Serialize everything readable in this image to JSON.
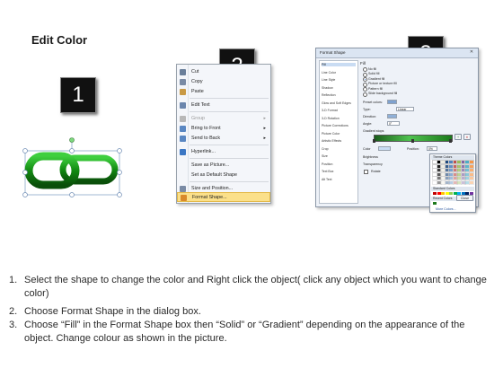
{
  "page": {
    "title": "Edit Color",
    "steps": [
      "1",
      "2",
      "3"
    ]
  },
  "context_menu": {
    "items": [
      {
        "label": "Cut",
        "icon": "scissors-icon",
        "color": "#6a7f9a"
      },
      {
        "label": "Copy",
        "icon": "copy-icon",
        "color": "#7a8ba5"
      },
      {
        "label": "Paste",
        "icon": "paste-icon",
        "color": "#c99a45"
      },
      {
        "label": "Edit Text",
        "icon": "edit-text-icon",
        "color": "#6b86ad"
      },
      {
        "label": "Group",
        "icon": "group-icon",
        "color": "#b8b8b8",
        "disabled": true,
        "submenu": true
      },
      {
        "label": "Bring to Front",
        "icon": "bring-front-icon",
        "color": "#5a87c2",
        "submenu": true
      },
      {
        "label": "Send to Back",
        "icon": "send-back-icon",
        "color": "#5a87c2",
        "submenu": true
      },
      {
        "label": "Hyperlink...",
        "icon": "hyperlink-icon",
        "color": "#3b77c4"
      },
      {
        "label": "Save as Picture...",
        "icon": "",
        "color": ""
      },
      {
        "label": "Set as Default Shape",
        "icon": "",
        "color": ""
      },
      {
        "label": "Size and Position...",
        "icon": "size-position-icon",
        "color": "#7a8ba5"
      },
      {
        "label": "Format Shape...",
        "icon": "format-shape-icon",
        "color": "#d98a2b",
        "highlighted": true
      }
    ]
  },
  "dialog": {
    "title": "Format Shape",
    "categories": [
      "Fill",
      "Line Color",
      "Line Style",
      "Shadow",
      "Reflection",
      "Glow and Soft Edges",
      "3-D Format",
      "3-D Rotation",
      "Picture Corrections",
      "Picture Color",
      "Artistic Effects",
      "Crop",
      "Size",
      "Position",
      "Text Box",
      "Alt Text"
    ],
    "heading": "Fill",
    "fill_options": [
      "No fill",
      "Solid fill",
      "Gradient fill",
      "Picture or texture fill",
      "Pattern fill",
      "Slide background fill"
    ],
    "selected_fill": "Gradient fill",
    "preset_colors_label": "Preset colors:",
    "type_label": "Type:",
    "type_value": "Linear",
    "direction_label": "Direction:",
    "angle_label": "Angle:",
    "angle_value": "0°",
    "gradient_stops_label": "Gradient stops",
    "color_label": "Color",
    "position_label": "Position:",
    "position_value": "0%",
    "brightness_label": "Brightness",
    "transparency_label": "Transparency",
    "rotate_label": "Rotate",
    "close_label": "Close",
    "palette": {
      "theme_colors_label": "Theme Colors",
      "standard_colors_label": "Standard Colors",
      "recent_colors_label": "Recent Colors",
      "more_colors_label": "More Colors...",
      "theme_colors": [
        "#ffffff",
        "#000000",
        "#eeece1",
        "#1f497d",
        "#4f81bd",
        "#c0504d",
        "#9bbb59",
        "#8064a2",
        "#4bacc6",
        "#f79646"
      ],
      "standard_colors": [
        "#c00000",
        "#ff0000",
        "#ffc000",
        "#ffff00",
        "#92d050",
        "#00b050",
        "#00b0f0",
        "#0070c0",
        "#002060",
        "#7030a0"
      ],
      "recent_colors": [
        "#1e7a1e"
      ]
    }
  },
  "instructions": [
    {
      "num": "1.",
      "text": "Select the shape to change the color and Right click the object( click any object which you want to change color)"
    },
    {
      "num": "2.",
      "text": "Choose Format Shape in the dialog box."
    },
    {
      "num": "3.",
      "text": "Choose “Fill” in the Format Shape box then “Solid” or “Gradient” depending on the appearance of the object. Change colour as shown in the picture."
    }
  ],
  "colors": {
    "chain_green": "#1e9a1e",
    "chain_dark": "#0d5a0d",
    "highlight": "#fbe08a"
  }
}
